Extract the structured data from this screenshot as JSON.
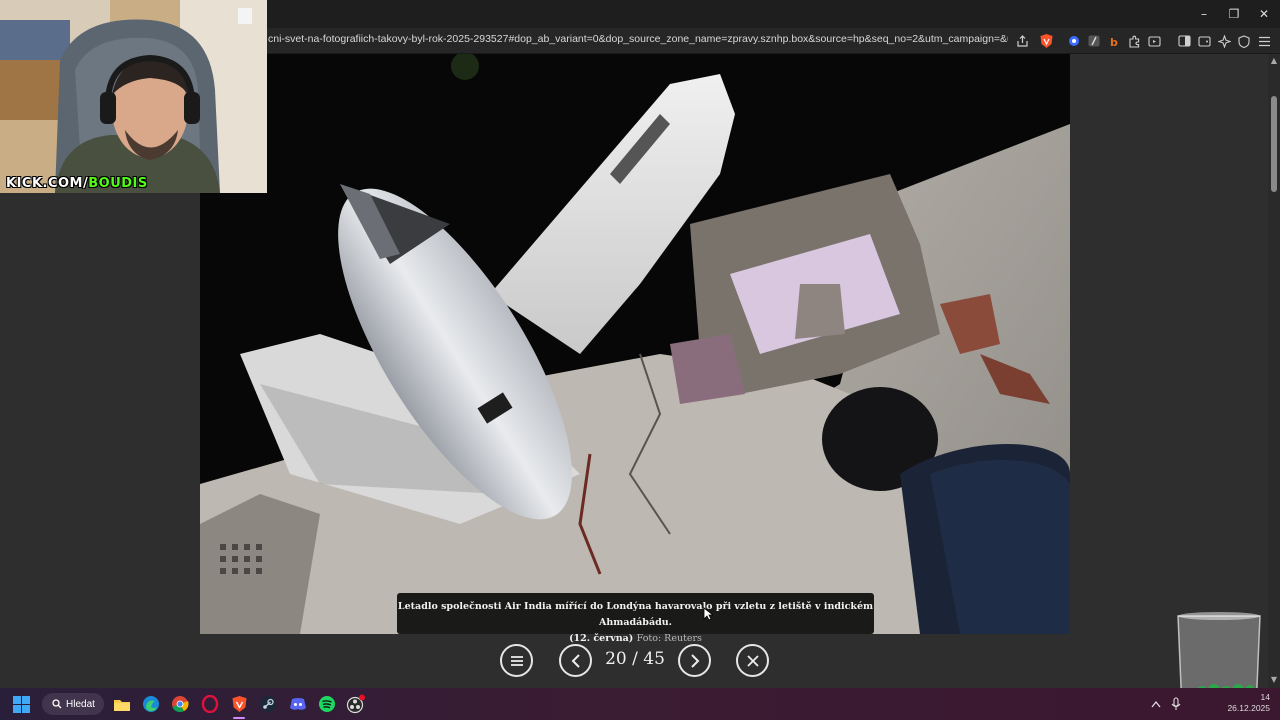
{
  "browser": {
    "url": "cni-svet-na-fotografiich-takovy-byl-rok-2025-293527#dop_ab_variant=0&dop_source_zone_name=zpravy.sznhp.box&source=hp&seq_no=2&utm_campaign=&utm_medium=z-...",
    "window_controls": {
      "minimize": "–",
      "restore": "❐",
      "close": "✕"
    }
  },
  "gallery": {
    "caption": "Letadlo společnosti Air India mířící do Londýna havarovalo při vzletu z letiště v indickém Ahmadábádu.",
    "caption_date": "(12. června)",
    "caption_credit": "Foto: Reuters",
    "counter": "20 / 45"
  },
  "webcam": {
    "label_prefix": "KICK.COM/",
    "label_user": "BOUDIS"
  },
  "taskbar": {
    "search_label": "Hledat",
    "time": "14",
    "date": "26.12.2025"
  },
  "colors": {
    "kick_green": "#53fc18",
    "page_bg": "#2e2e2e",
    "taskbar_accent": "#d08cff"
  }
}
